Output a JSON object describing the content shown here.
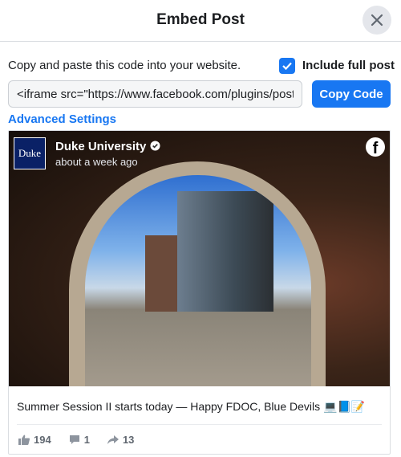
{
  "dialog": {
    "title": "Embed Post",
    "close_icon": "close-icon"
  },
  "instructions": "Copy and paste this code into your website.",
  "include_full_post": {
    "label": "Include full post",
    "checked": true
  },
  "code_value": "<iframe src=\"https://www.facebook.com/plugins/post.php",
  "copy_label": "Copy Code",
  "advanced_label": "Advanced Settings",
  "post": {
    "logo_text": "Duke",
    "page_name": "Duke University",
    "time": "about a week ago",
    "caption": "Summer Session II starts today — Happy FDOC, Blue Devils 💻📘📝",
    "likes": "194",
    "comments": "1",
    "shares": "13"
  },
  "colors": {
    "accent": "#1877f2",
    "logo_bg": "#0a2166"
  }
}
